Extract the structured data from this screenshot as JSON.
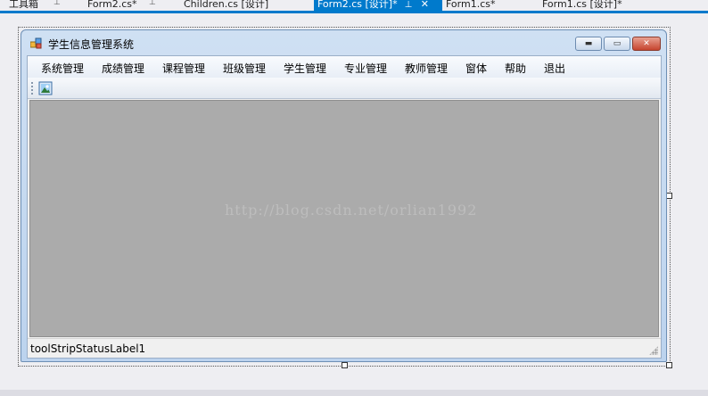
{
  "ide": {
    "toolbox_label": "工具箱",
    "tabs": [
      {
        "label": "Form2.cs*",
        "active": false
      },
      {
        "label": "Children.cs [设计]",
        "active": false
      },
      {
        "label": "Form2.cs [设计]*",
        "active": true
      },
      {
        "label": "Form1.cs*",
        "active": false
      },
      {
        "label": "Form1.cs [设计]*",
        "active": false
      }
    ],
    "active_tab_color": "#007acc"
  },
  "form": {
    "title": "学生信息管理系统",
    "menu": [
      "系统管理",
      "成绩管理",
      "课程管理",
      "班级管理",
      "学生管理",
      "专业管理",
      "教师管理",
      "窗体",
      "帮助",
      "退出"
    ],
    "toolbar_button_icon": "picture-icon",
    "watermark": "http://blog.csdn.net/orlian1992",
    "status_label": "toolStripStatusLabel1",
    "mdi_background": "#ababab"
  }
}
